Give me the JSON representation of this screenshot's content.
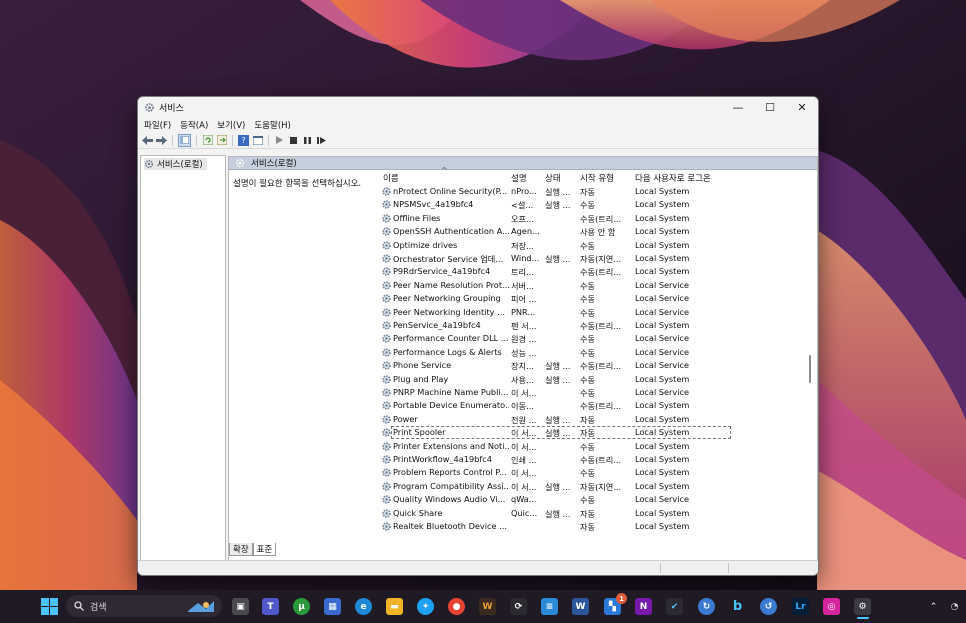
{
  "window": {
    "title": "서비스",
    "minimize": "—",
    "maximize": "☐",
    "close": "✕"
  },
  "menu": [
    "파일(F)",
    "동작(A)",
    "보기(V)",
    "도움말(H)"
  ],
  "left_pane": {
    "node_label": "서비스(로컬)"
  },
  "right_pane": {
    "header": "서비스(로컬)",
    "description": "설명이 필요한 항목을 선택하십시오."
  },
  "columns": {
    "name": "이름",
    "description": "설명",
    "status": "상태",
    "startup": "시작 유형",
    "logon": "다음 사용자로 로그온"
  },
  "services": [
    {
      "name": "nProtect Online Security(P...",
      "desc": "nPro...",
      "status": "실행 ...",
      "startup": "자동",
      "logon": "Local System"
    },
    {
      "name": "NPSMSvc_4a19bfc4",
      "desc": "<설...",
      "status": "실행 ...",
      "startup": "수동",
      "logon": "Local System"
    },
    {
      "name": "Offline Files",
      "desc": "오프...",
      "status": "",
      "startup": "수동(트리...",
      "logon": "Local System"
    },
    {
      "name": "OpenSSH Authentication A...",
      "desc": "Agen...",
      "status": "",
      "startup": "사용 안 함",
      "logon": "Local System"
    },
    {
      "name": "Optimize drives",
      "desc": "저장...",
      "status": "",
      "startup": "수동",
      "logon": "Local System"
    },
    {
      "name": "Orchestrator Service 업데...",
      "desc": "Wind...",
      "status": "실행 ...",
      "startup": "자동(지연...",
      "logon": "Local System"
    },
    {
      "name": "P9RdrService_4a19bfc4",
      "desc": "트리...",
      "status": "",
      "startup": "수동(트리...",
      "logon": "Local System"
    },
    {
      "name": "Peer Name Resolution Prot...",
      "desc": "서버...",
      "status": "",
      "startup": "수동",
      "logon": "Local Service"
    },
    {
      "name": "Peer Networking Grouping",
      "desc": "피어 ...",
      "status": "",
      "startup": "수동",
      "logon": "Local Service"
    },
    {
      "name": "Peer Networking Identity ...",
      "desc": "PNR...",
      "status": "",
      "startup": "수동",
      "logon": "Local Service"
    },
    {
      "name": "PenService_4a19bfc4",
      "desc": "펜 서...",
      "status": "",
      "startup": "수동(트리...",
      "logon": "Local System"
    },
    {
      "name": "Performance Counter DLL ...",
      "desc": "원경 ...",
      "status": "",
      "startup": "수동",
      "logon": "Local Service"
    },
    {
      "name": "Performance Logs & Alerts",
      "desc": "성능 ...",
      "status": "",
      "startup": "수동",
      "logon": "Local Service"
    },
    {
      "name": "Phone Service",
      "desc": "장치...",
      "status": "실행 ...",
      "startup": "수동(트리...",
      "logon": "Local Service"
    },
    {
      "name": "Plug and Play",
      "desc": "사용...",
      "status": "실행 ...",
      "startup": "수동",
      "logon": "Local System"
    },
    {
      "name": "PNRP Machine Name Publi...",
      "desc": "이 서...",
      "status": "",
      "startup": "수동",
      "logon": "Local Service"
    },
    {
      "name": "Portable Device Enumerato...",
      "desc": "이동...",
      "status": "",
      "startup": "수동(트리...",
      "logon": "Local System"
    },
    {
      "name": "Power",
      "desc": "전원 ...",
      "status": "실행 ...",
      "startup": "자동",
      "logon": "Local System"
    },
    {
      "name": "Print Spooler",
      "desc": "이 서...",
      "status": "실행 ...",
      "startup": "자동",
      "logon": "Local System",
      "selected": true
    },
    {
      "name": "Printer Extensions and Noti...",
      "desc": "이 서...",
      "status": "",
      "startup": "수동",
      "logon": "Local System"
    },
    {
      "name": "PrintWorkflow_4a19bfc4",
      "desc": "인쇄 ...",
      "status": "",
      "startup": "수동(트리...",
      "logon": "Local System"
    },
    {
      "name": "Problem Reports Control P...",
      "desc": "이 서...",
      "status": "",
      "startup": "수동",
      "logon": "Local System"
    },
    {
      "name": "Program Compatibility Assi...",
      "desc": "이 서...",
      "status": "실행 ...",
      "startup": "자동(지연...",
      "logon": "Local System"
    },
    {
      "name": "Quality Windows Audio Vi...",
      "desc": "qWa...",
      "status": "",
      "startup": "수동",
      "logon": "Local Service"
    },
    {
      "name": "Quick Share",
      "desc": "Quic...",
      "status": "실행 ...",
      "startup": "자동",
      "logon": "Local System"
    },
    {
      "name": "Realtek Bluetooth Device ...",
      "desc": "",
      "status": "",
      "startup": "자동",
      "logon": "Local System"
    }
  ],
  "tabs": [
    "확장",
    "표준"
  ],
  "taskbar": {
    "search_placeholder": "검색",
    "badge_count": "1"
  }
}
